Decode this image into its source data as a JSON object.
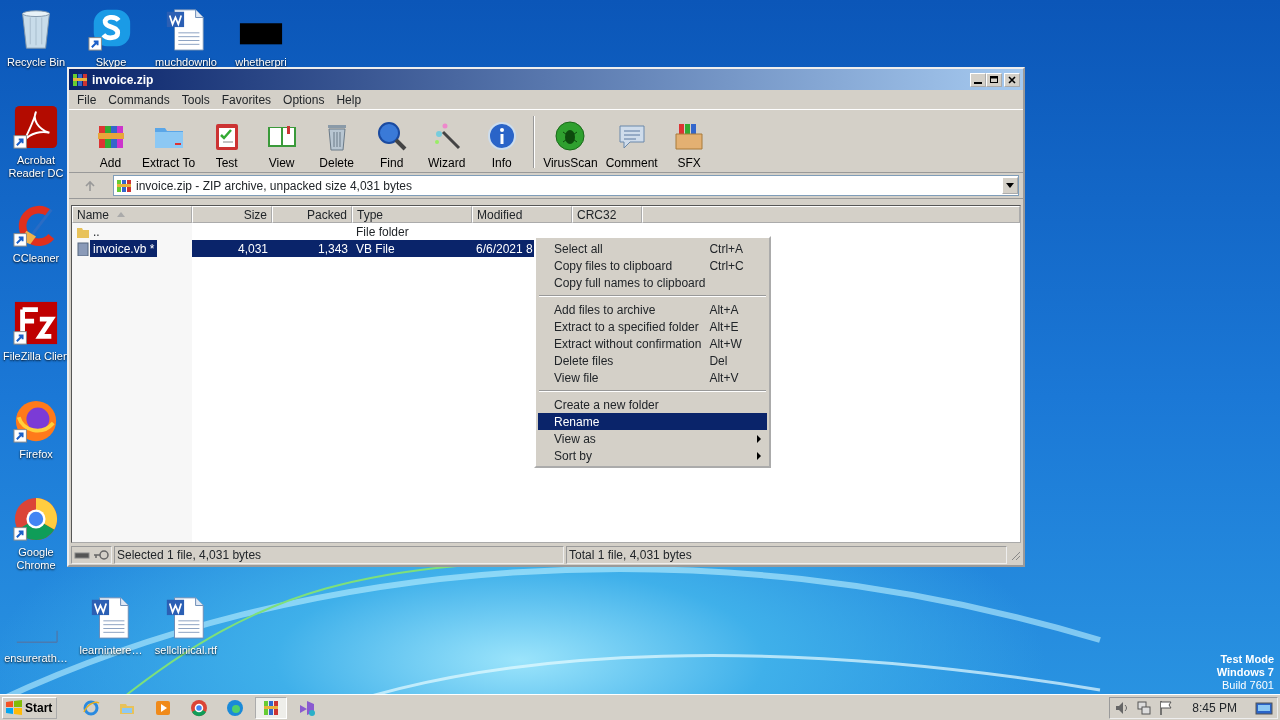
{
  "desktop": {
    "icons": [
      {
        "label": "Recycle Bin",
        "kind": "recycle",
        "shortcut": false
      },
      {
        "label": "Skype",
        "kind": "skype",
        "shortcut": true
      },
      {
        "label": "muchdownlo",
        "kind": "word",
        "shortcut": false
      },
      {
        "label": "whetherpri",
        "kind": "black",
        "shortcut": false
      },
      {
        "label": "Acrobat Reader DC",
        "kind": "acrobat",
        "shortcut": true
      },
      {
        "label": "CCleaner",
        "kind": "ccleaner",
        "shortcut": true
      },
      {
        "label": "FileZilla Clien",
        "kind": "filezilla",
        "shortcut": true
      },
      {
        "label": "Firefox",
        "kind": "firefox",
        "shortcut": true
      },
      {
        "label": "Google Chrome",
        "kind": "chrome",
        "shortcut": true
      },
      {
        "label": "ensurerath…",
        "kind": "blank",
        "shortcut": false
      },
      {
        "label": "learnintere…",
        "kind": "word",
        "shortcut": false
      },
      {
        "label": "sellclinical.rtf",
        "kind": "word",
        "shortcut": false
      }
    ],
    "system_text": [
      "Test Mode",
      "Windows 7",
      "Build 7601"
    ]
  },
  "window": {
    "title": "invoice.zip",
    "menu": [
      "File",
      "Commands",
      "Tools",
      "Favorites",
      "Options",
      "Help"
    ],
    "toolbar": [
      [
        {
          "label": "Add",
          "kind": "add"
        },
        {
          "label": "Extract To",
          "kind": "extract"
        },
        {
          "label": "Test",
          "kind": "test"
        },
        {
          "label": "View",
          "kind": "view"
        },
        {
          "label": "Delete",
          "kind": "delete"
        },
        {
          "label": "Find",
          "kind": "find"
        },
        {
          "label": "Wizard",
          "kind": "wizard"
        },
        {
          "label": "Info",
          "kind": "info"
        }
      ],
      [
        {
          "label": "VirusScan",
          "kind": "virus"
        },
        {
          "label": "Comment",
          "kind": "comment"
        },
        {
          "label": "SFX",
          "kind": "sfx"
        }
      ]
    ],
    "address": "invoice.zip - ZIP archive, unpacked size 4,031 bytes",
    "columns": [
      {
        "label": "Name",
        "sorted": true
      },
      {
        "label": "Size",
        "sorted": false
      },
      {
        "label": "Packed",
        "sorted": false
      },
      {
        "label": "Type",
        "sorted": false
      },
      {
        "label": "Modified",
        "sorted": false
      },
      {
        "label": "CRC32",
        "sorted": false
      }
    ],
    "rows": [
      {
        "kind": "folder",
        "selected": false,
        "cells": [
          "..",
          "",
          "",
          "File folder",
          "",
          ""
        ]
      },
      {
        "kind": "file",
        "selected": true,
        "cells": [
          "invoice.vb *",
          "4,031",
          "1,343",
          "VB File",
          "6/6/2021 8",
          ""
        ]
      }
    ],
    "status": [
      "Selected 1 file, 4,031 bytes",
      "Total 1 file, 4,031 bytes"
    ]
  },
  "context_menu": {
    "items": [
      {
        "kind": "item",
        "label": "Select all",
        "shortcut": "Ctrl+A",
        "selected": false
      },
      {
        "kind": "item",
        "label": "Copy files to clipboard",
        "shortcut": "Ctrl+C",
        "selected": false
      },
      {
        "kind": "item",
        "label": "Copy full names to clipboard",
        "selected": false
      },
      {
        "kind": "separator"
      },
      {
        "kind": "item",
        "label": "Add files to archive",
        "shortcut": "Alt+A",
        "selected": false
      },
      {
        "kind": "item",
        "label": "Extract to a specified folder",
        "shortcut": "Alt+E",
        "selected": false
      },
      {
        "kind": "item",
        "label": "Extract without confirmation",
        "shortcut": "Alt+W",
        "selected": false
      },
      {
        "kind": "item",
        "label": "Delete files",
        "shortcut": "Del",
        "selected": false
      },
      {
        "kind": "item",
        "label": "View file",
        "shortcut": "Alt+V",
        "selected": false
      },
      {
        "kind": "separator"
      },
      {
        "kind": "item",
        "label": "Create a new folder",
        "selected": false
      },
      {
        "kind": "item",
        "label": "Rename",
        "selected": true
      },
      {
        "kind": "submenu",
        "label": "View as",
        "selected": false
      },
      {
        "kind": "submenu",
        "label": "Sort by",
        "selected": false
      }
    ]
  },
  "taskbar": {
    "start": "Start",
    "apps": [
      {
        "kind": "ie",
        "active": false
      },
      {
        "kind": "explorer",
        "active": false
      },
      {
        "kind": "media",
        "active": false
      },
      {
        "kind": "chrome",
        "active": false
      },
      {
        "kind": "edge",
        "active": false
      },
      {
        "kind": "winrar",
        "active": true
      },
      {
        "kind": "vs",
        "active": false
      }
    ],
    "clock": "8:45 PM"
  }
}
